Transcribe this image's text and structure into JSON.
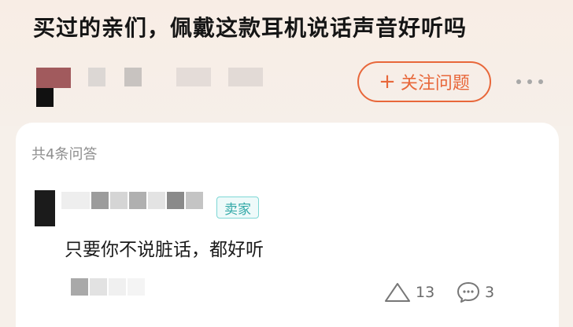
{
  "question": {
    "title": "买过的亲们，佩戴这款耳机说话声音好听吗",
    "follow_button": {
      "plus": "+",
      "label": "关注问题"
    },
    "more_icon": "more-horizontal-icon"
  },
  "answers": {
    "count_label": "共4条问答",
    "items": [
      {
        "badge": "卖家",
        "text": "只要你不说脏话，都好听",
        "likes": "13",
        "comments": "3",
        "like_icon": "thumb-triangle-icon",
        "comment_icon": "comment-bubble-icon"
      }
    ]
  },
  "colors": {
    "accent": "#e8673a",
    "badge_text": "#33a9a8",
    "badge_border": "#7dd7d5",
    "header_bg": "#f8ede5"
  }
}
